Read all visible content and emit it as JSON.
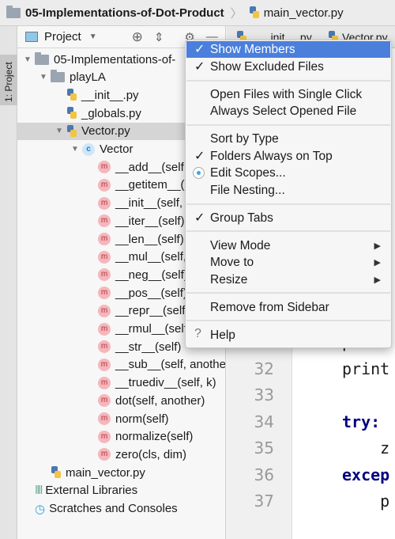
{
  "breadcrumb": {
    "project": "05-Implementations-of-Dot-Product",
    "file": "main_vector.py"
  },
  "stripe": {
    "label": "1: Project"
  },
  "panel": {
    "title": "Project",
    "tree": [
      {
        "label": "05-Implementations-of-",
        "kind": "folder",
        "depth": 0,
        "expanded": true
      },
      {
        "label": "playLA",
        "kind": "package",
        "depth": 1,
        "expanded": true
      },
      {
        "label": "__init__.py",
        "kind": "py",
        "depth": 2
      },
      {
        "label": "_globals.py",
        "kind": "py",
        "depth": 2
      },
      {
        "label": "Vector.py",
        "kind": "py",
        "depth": 2,
        "expanded": true,
        "selected": true
      },
      {
        "label": "Vector",
        "kind": "class",
        "depth": 3,
        "expanded": true
      },
      {
        "label": "__add__(self,",
        "kind": "method",
        "depth": 4
      },
      {
        "label": "__getitem__(",
        "kind": "method",
        "depth": 4
      },
      {
        "label": "__init__(self,",
        "kind": "method",
        "depth": 4
      },
      {
        "label": "__iter__(self)",
        "kind": "method",
        "depth": 4
      },
      {
        "label": "__len__(self)",
        "kind": "method",
        "depth": 4
      },
      {
        "label": "__mul__(self,",
        "kind": "method",
        "depth": 4
      },
      {
        "label": "__neg__(self)",
        "kind": "method",
        "depth": 4
      },
      {
        "label": "__pos__(self)",
        "kind": "method",
        "depth": 4
      },
      {
        "label": "__repr__(self",
        "kind": "method",
        "depth": 4
      },
      {
        "label": "__rmul__(self",
        "kind": "method",
        "depth": 4
      },
      {
        "label": "__str__(self)",
        "kind": "method",
        "depth": 4
      },
      {
        "label": "__sub__(self, anothe",
        "kind": "method",
        "depth": 4
      },
      {
        "label": "__truediv__(self, k)",
        "kind": "method",
        "depth": 4
      },
      {
        "label": "dot(self, another)",
        "kind": "method",
        "depth": 4
      },
      {
        "label": "norm(self)",
        "kind": "method",
        "depth": 4
      },
      {
        "label": "normalize(self)",
        "kind": "method",
        "depth": 4
      },
      {
        "label": "zero(cls, dim)",
        "kind": "method",
        "depth": 4
      },
      {
        "label": "main_vector.py",
        "kind": "py",
        "depth": 1
      },
      {
        "label": "External Libraries",
        "kind": "libs",
        "depth": 0
      },
      {
        "label": "Scratches and Consoles",
        "kind": "scratch",
        "depth": 0
      }
    ]
  },
  "editor": {
    "tabs": [
      "__init__.py",
      "Vector.py"
    ],
    "lines": [
      {
        "n": "31",
        "code": "print",
        "kw": false
      },
      {
        "n": "32",
        "code": "print",
        "kw": false
      },
      {
        "n": "33",
        "code": "",
        "kw": false
      },
      {
        "n": "34",
        "code": "try:",
        "kw": true
      },
      {
        "n": "35",
        "code": "    z",
        "kw": false
      },
      {
        "n": "36",
        "code": "excep",
        "kw": true
      },
      {
        "n": "37",
        "code": "    p",
        "kw": false
      }
    ]
  },
  "menu": {
    "items": [
      {
        "label": "Show Members",
        "mark": "check",
        "highlighted": true
      },
      {
        "label": "Show Excluded Files",
        "mark": "check"
      },
      {
        "sep": true
      },
      {
        "label": "Open Files with Single Click"
      },
      {
        "label": "Always Select Opened File"
      },
      {
        "sep": true
      },
      {
        "label": "Sort by Type"
      },
      {
        "label": "Folders Always on Top",
        "mark": "check"
      },
      {
        "label": "Edit Scopes...",
        "mark": "radio"
      },
      {
        "label": "File Nesting..."
      },
      {
        "sep": true
      },
      {
        "label": "Group Tabs",
        "mark": "check"
      },
      {
        "sep": true
      },
      {
        "label": "View Mode",
        "submenu": true
      },
      {
        "label": "Move to",
        "submenu": true
      },
      {
        "label": "Resize",
        "submenu": true
      },
      {
        "sep": true
      },
      {
        "label": "Remove from Sidebar"
      },
      {
        "sep": true
      },
      {
        "label": "Help",
        "mark": "question"
      }
    ]
  },
  "colors": {
    "highlight": "#4a7fdc",
    "method_icon": "#f6b6bd",
    "keyword": "#000080"
  }
}
